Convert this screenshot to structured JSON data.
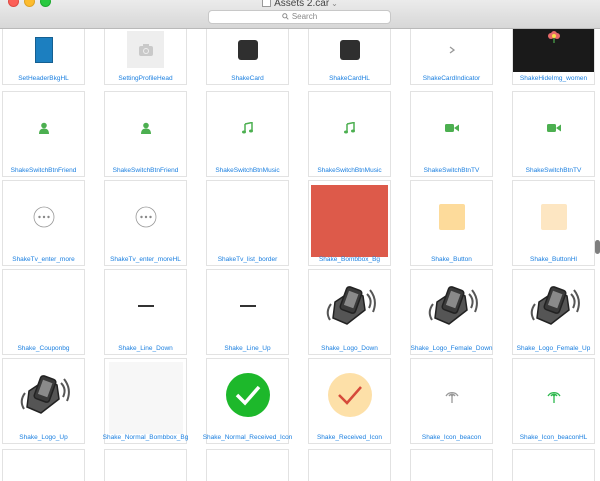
{
  "window": {
    "title": "Assets 2.car",
    "search_placeholder": "Search"
  },
  "assets": [
    {
      "name": "SetHeaderBkgHL",
      "icon": "blue-rectangle"
    },
    {
      "name": "SettingProfileHead",
      "icon": "camera-icon"
    },
    {
      "name": "ShakeCard",
      "icon": "dark-square"
    },
    {
      "name": "ShakeCardHL",
      "icon": "dark-square"
    },
    {
      "name": "ShakeCardIndicator",
      "icon": "chevron-right-icon"
    },
    {
      "name": "ShakeHideImg_women",
      "icon": "flower-icon"
    },
    {
      "name": "ShakeSwitchBtnFriend",
      "icon": "person-icon"
    },
    {
      "name": "ShakeSwitchBtnFriend",
      "icon": "person-icon"
    },
    {
      "name": "ShakeSwitchBtnMusic",
      "icon": "music-note-icon"
    },
    {
      "name": "ShakeSwitchBtnMusic",
      "icon": "music-note-icon"
    },
    {
      "name": "ShakeSwitchBtnTV",
      "icon": "video-camera-icon"
    },
    {
      "name": "ShakeSwitchBtnTV",
      "icon": "video-camera-icon"
    },
    {
      "name": "ShakeTv_enter_more",
      "icon": "more-circle-icon"
    },
    {
      "name": "ShakeTv_enter_moreHL",
      "icon": "more-circle-icon"
    },
    {
      "name": "ShakeTv_list_border",
      "icon": "blank"
    },
    {
      "name": "Shake_Bombbox_Bg",
      "icon": "red-square"
    },
    {
      "name": "Shake_Button",
      "icon": "peach-square"
    },
    {
      "name": "Shake_ButtonHl",
      "icon": "peach-square-light"
    },
    {
      "name": "Shake_Couponbg",
      "icon": "blank"
    },
    {
      "name": "Shake_Line_Down",
      "icon": "dash-line"
    },
    {
      "name": "Shake_Line_Up",
      "icon": "dash-line"
    },
    {
      "name": "Shake_Logo_Down",
      "icon": "shake-phone-hand-icon"
    },
    {
      "name": "Shake_Logo_Female_Down",
      "icon": "shake-phone-hand-icon"
    },
    {
      "name": "Shake_Logo_Female_Up",
      "icon": "shake-phone-hand-icon"
    },
    {
      "name": "Shake_Logo_Up",
      "icon": "shake-phone-hand-icon"
    },
    {
      "name": "Shake_Normal_Bombbox_Bg",
      "icon": "light-square"
    },
    {
      "name": "Shake_Normal_Received_Icon",
      "icon": "green-check-circle-icon"
    },
    {
      "name": "Shake_Received_Icon",
      "icon": "peach-check-circle-icon"
    },
    {
      "name": "Shake_Icon_beacon",
      "icon": "beacon-icon"
    },
    {
      "name": "Shake_Icon_beaconHL",
      "icon": "beacon-green-icon"
    },
    {
      "name": "",
      "icon": "blank"
    },
    {
      "name": "",
      "icon": "blank"
    },
    {
      "name": "",
      "icon": "blank"
    },
    {
      "name": "",
      "icon": "blank"
    },
    {
      "name": "",
      "icon": "blank"
    },
    {
      "name": "",
      "icon": "blank"
    }
  ]
}
